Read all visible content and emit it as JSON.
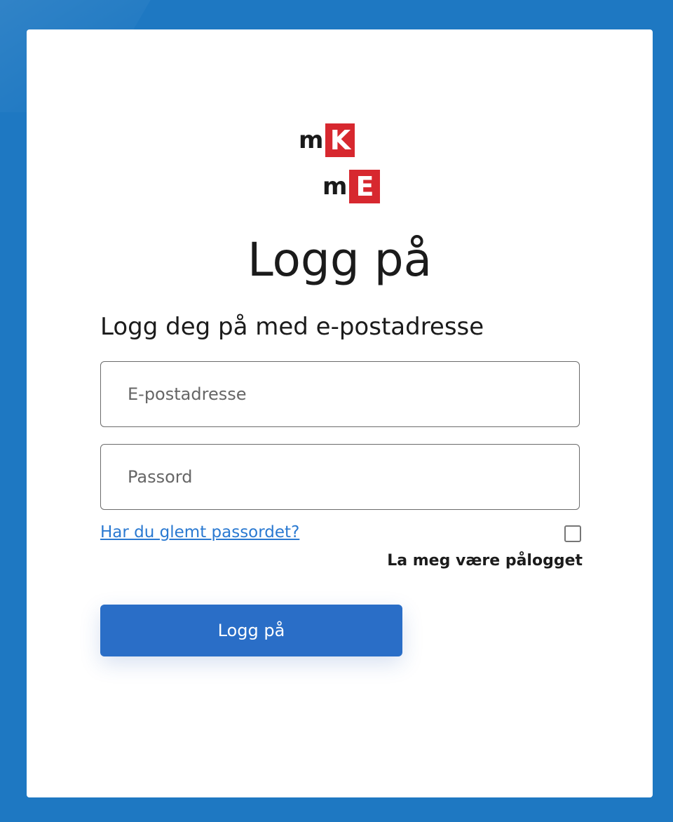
{
  "logo": {
    "line1_lower": "m",
    "line1_box": "K",
    "line2_lower": "m",
    "line2_box": "E",
    "accent_color": "#d7282f"
  },
  "page": {
    "title": "Logg på",
    "subtitle": "Logg deg på med e-postadresse"
  },
  "form": {
    "email_placeholder": "E-postadresse",
    "email_value": "",
    "password_placeholder": "Passord",
    "password_value": "",
    "forgot_link": "Har du glemt passordet?",
    "remember_label": "La meg være pålogget",
    "remember_checked": false,
    "submit_label": "Logg på"
  },
  "colors": {
    "background": "#1e78c2",
    "button": "#2a6ec7",
    "link": "#2a79d1"
  }
}
